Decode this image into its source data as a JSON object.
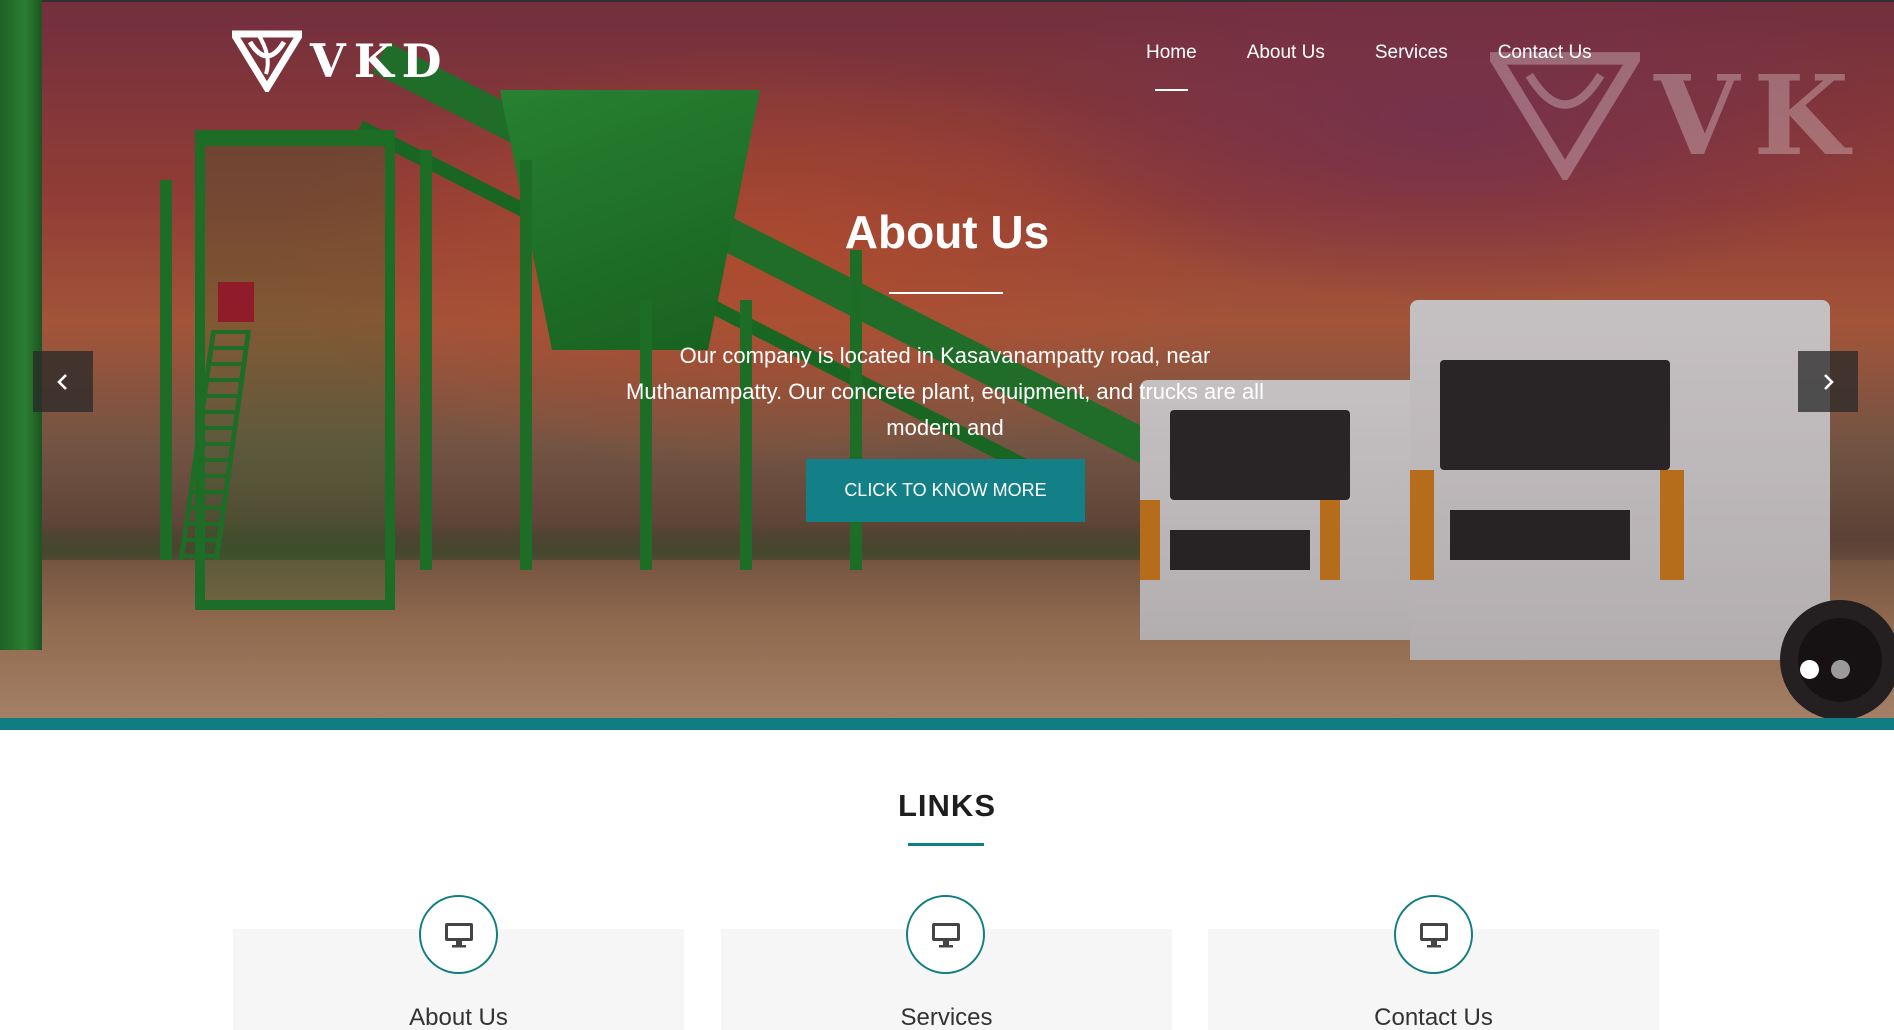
{
  "brand": {
    "name": "VKD",
    "watermark": "VK"
  },
  "nav": {
    "items": [
      {
        "label": "Home",
        "active": true
      },
      {
        "label": "About Us",
        "active": false
      },
      {
        "label": "Services",
        "active": false
      },
      {
        "label": "Contact Us",
        "active": false
      }
    ]
  },
  "hero": {
    "title": "About Us",
    "text": "Our company is located in Kasavanampatty road, near Muthanampatty. Our concrete plant, equipment, and trucks are all modern and",
    "cta_label": "CLICK TO KNOW MORE",
    "prev_icon": "chevron-left-icon",
    "next_icon": "chevron-right-icon",
    "slides": [
      {
        "active": true
      },
      {
        "active": false
      }
    ]
  },
  "links": {
    "title": "LINKS",
    "cards": [
      {
        "label": "About Us",
        "icon": "monitor-icon"
      },
      {
        "label": "Services",
        "icon": "monitor-icon"
      },
      {
        "label": "Contact Us",
        "icon": "monitor-icon"
      }
    ]
  },
  "colors": {
    "accent": "#117d82",
    "text_dark": "#1e1e1e",
    "card_bg": "#f6f6f6"
  }
}
